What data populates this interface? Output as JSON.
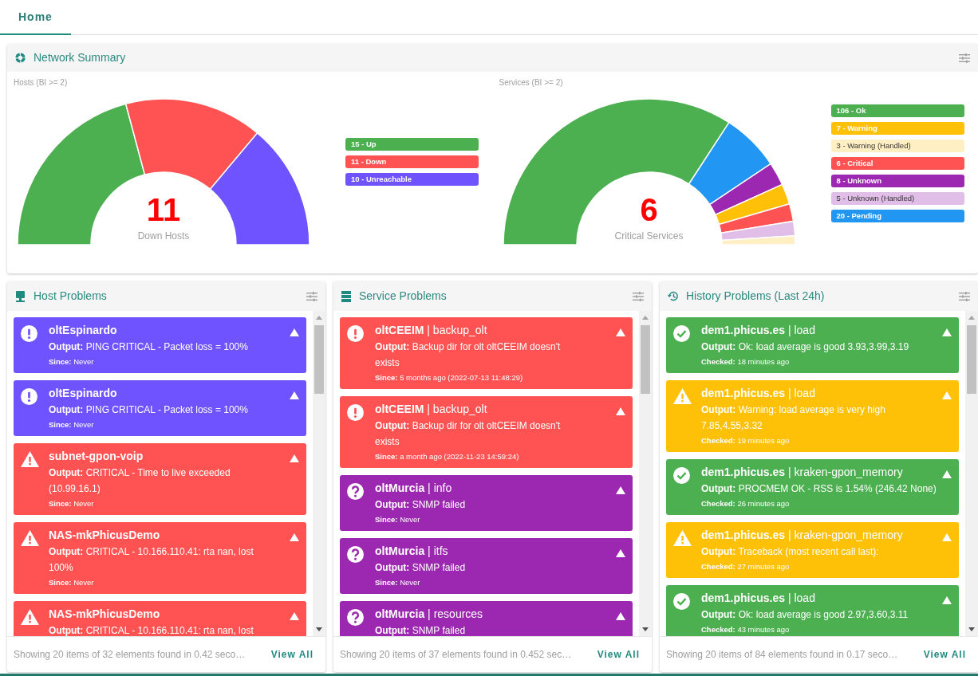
{
  "tabs": [
    {
      "label": "Home",
      "selected": true
    }
  ],
  "network_summary": {
    "title": "Network Summary",
    "panels": [
      {
        "caption": "Hosts (BI >= 2)",
        "center_value": "11",
        "center_label": "Down Hosts",
        "legend": [
          {
            "label": "15 - Up",
            "color": "#4caf50"
          },
          {
            "label": "11 - Down",
            "color": "#ff5252"
          },
          {
            "label": "10 - Unreachable",
            "color": "#6e53ff"
          }
        ],
        "chart_data": {
          "type": "donut",
          "values": [
            41.67,
            30.56,
            27.77
          ],
          "colors": [
            "#4caf50",
            "#ff5252",
            "#6e53ff"
          ]
        }
      },
      {
        "caption": "Services (BI >= 2)",
        "center_value": "6",
        "center_label": "Critical Services",
        "legend": [
          {
            "label": "106 - Ok",
            "color": "#4caf50"
          },
          {
            "label": "7 - Warning",
            "color": "#ffc107"
          },
          {
            "label": "3 - Warning (Handled)",
            "color": "#ffefc2"
          },
          {
            "label": "6 - Critical",
            "color": "#ff5252"
          },
          {
            "label": "8 - Unknown",
            "color": "#9c27b0"
          },
          {
            "label": "5 - Unknown (Handled)",
            "color": "#e1bee7"
          },
          {
            "label": "20 - Pending",
            "color": "#2196f3"
          }
        ],
        "chart_data": {
          "type": "donut",
          "values": [
            68.38,
            12.9,
            5.16,
            4.52,
            3.87,
            3.23,
            1.94
          ],
          "colors": [
            "#4caf50",
            "#2196f3",
            "#9c27b0",
            "#ffc107",
            "#ff5252",
            "#e1bee7",
            "#ffefc2"
          ]
        }
      }
    ]
  },
  "problem_panels": [
    {
      "title": "Host Problems",
      "kind": "hosts",
      "footer": "Showing 20 items of 32 elements found in 0.42 seco…",
      "link": "View All",
      "items": [
        {
          "kind": "exclamation",
          "color": "#6e53ff",
          "title": "oltEspinardo",
          "output": "**Output:** PING CRITICAL - Packet loss = 100%",
          "since": "**Since:** Never"
        },
        {
          "kind": "exclamation",
          "color": "#6e53ff",
          "title": "oltEspinardo",
          "output": "**Output:** PING CRITICAL - Packet loss = 100%",
          "since": "**Since:** Never"
        },
        {
          "kind": "warning",
          "color": "#ff5252",
          "title": "subnet-gpon-voip",
          "output": "**Output:** CRITICAL - Time to live exceeded (10.99.16.1)",
          "since": "**Since:** Never"
        },
        {
          "kind": "warning",
          "color": "#ff5252",
          "title": "NAS-mkPhicusDemo",
          "output": "**Output:** CRITICAL - 10.166.110.41: rta nan, lost 100%",
          "since": "**Since:** Never"
        },
        {
          "kind": "warning",
          "color": "#ff5252",
          "title": "NAS-mkPhicusDemo",
          "output": "**Output:** CRITICAL - 10.166.110.41: rta nan, lost"
        }
      ]
    },
    {
      "title": "Service Problems",
      "kind": "services",
      "footer": "Showing 20 items of 37 elements found in 0.452 sec…",
      "link": "View All",
      "items": [
        {
          "kind": "exclamation",
          "color": "#ff5252",
          "title": "**oltCEEIM** | backup_olt",
          "output": "**Output:** Backup dir for olt oltCEEIM doesn't exists",
          "since": "**Since:** 5 months ago (2022-07-13 11:48:29)"
        },
        {
          "kind": "exclamation",
          "color": "#ff5252",
          "title": "**oltCEEIM** | backup_olt",
          "output": "**Output:** Backup dir for olt oltCEEIM doesn't exists",
          "since": "**Since:** a month ago (2022-11-23 14:59:24)"
        },
        {
          "kind": "question",
          "color": "#9c27b0",
          "title": "**oltMurcia** | info",
          "output": "**Output:** SNMP failed",
          "since": "**Since:** Never"
        },
        {
          "kind": "question",
          "color": "#9c27b0",
          "title": "**oltMurcia** | itfs",
          "output": "**Output:** SNMP failed",
          "since": "**Since:** Never"
        },
        {
          "kind": "question",
          "color": "#9c27b0",
          "title": "**oltMurcia** | resources",
          "output": "**Output:** SNMP failed"
        }
      ]
    },
    {
      "title": "History Problems (Last 24h)",
      "kind": "history",
      "footer": "Showing 20 items of 84 elements found in 0.17 seco…",
      "link": "View All",
      "items": [
        {
          "kind": "check",
          "color": "#4caf50",
          "title": "**dem1.phicus.es** | load",
          "output": "**Output:** Ok: load average is good 3.93,3.99,3.19",
          "since": "**Checked:** 18 minutes ago"
        },
        {
          "kind": "warning",
          "color": "#ffc107",
          "title": "**dem1.phicus.es** | load",
          "output": "**Output:** Warning: load average is very high 7.85,4.55,3.32",
          "since": "**Checked:** 19 minutes ago"
        },
        {
          "kind": "check",
          "color": "#4caf50",
          "title": "**dem1.phicus.es** | kraken-gpon_memory",
          "output": "**Output:** PROCMEM OK - RSS is 1.54% (246.42 None)",
          "since": "**Checked:** 26 minutes ago"
        },
        {
          "kind": "warning",
          "color": "#ffc107",
          "title": "**dem1.phicus.es** | kraken-gpon_memory",
          "output": "**Output:** Traceback (most recent call last):",
          "since": "**Checked:** 27 minutes ago"
        },
        {
          "kind": "check",
          "color": "#4caf50",
          "title": "**dem1.phicus.es** | load",
          "output": "**Output:** Ok: load average is good 2.97,3.60,3.11",
          "since": "**Checked:** 43 minutes ago"
        }
      ]
    }
  ]
}
